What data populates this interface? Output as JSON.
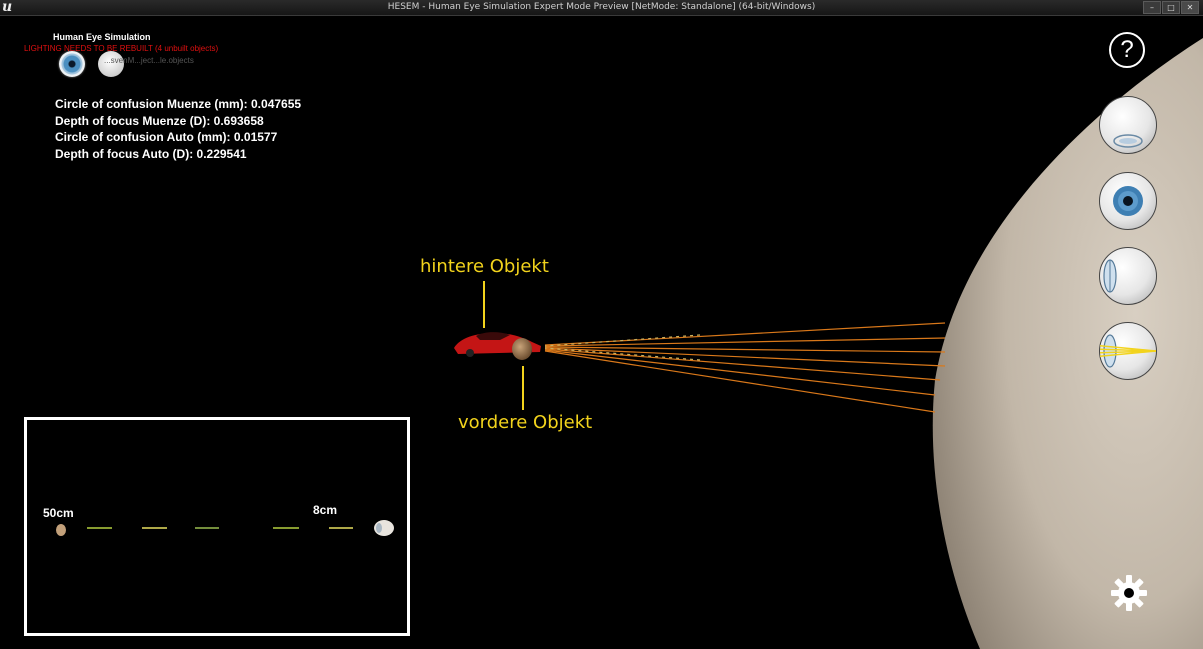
{
  "window": {
    "title": "HESEM - Human Eye Simulation Expert Mode Preview [NetMode: Standalone] (64-bit/Windows)",
    "logo": "u",
    "buttons": {
      "minimize": "–",
      "maximize": "□",
      "close": "✕"
    }
  },
  "hud": {
    "title": "Human Eye Simulation",
    "warning": "LIGHTING NEEDS TO BE REBUILT (4 unbuilt objects)",
    "faded_text": "...svenM...ject...le.objects",
    "metrics": [
      "Circle of confusion Muenze (mm): 0.047655",
      "Depth of focus Muenze (D): 0.693658",
      "Circle of confusion Auto (mm): 0.01577",
      "Depth of focus Auto (D): 0.229541"
    ]
  },
  "scene": {
    "label_back": "hintere Objekt",
    "label_front": "vordere Objekt",
    "ray_color": "#d9781a",
    "label_color": "#f2d31c"
  },
  "minimap": {
    "label_far": "50cm",
    "label_near": "8cm"
  },
  "toolbar": {
    "help": "?",
    "icons": [
      "help-icon",
      "eye-lens-icon",
      "eye-front-icon",
      "eye-side-icon",
      "eye-rays-icon",
      "gear-icon"
    ]
  }
}
